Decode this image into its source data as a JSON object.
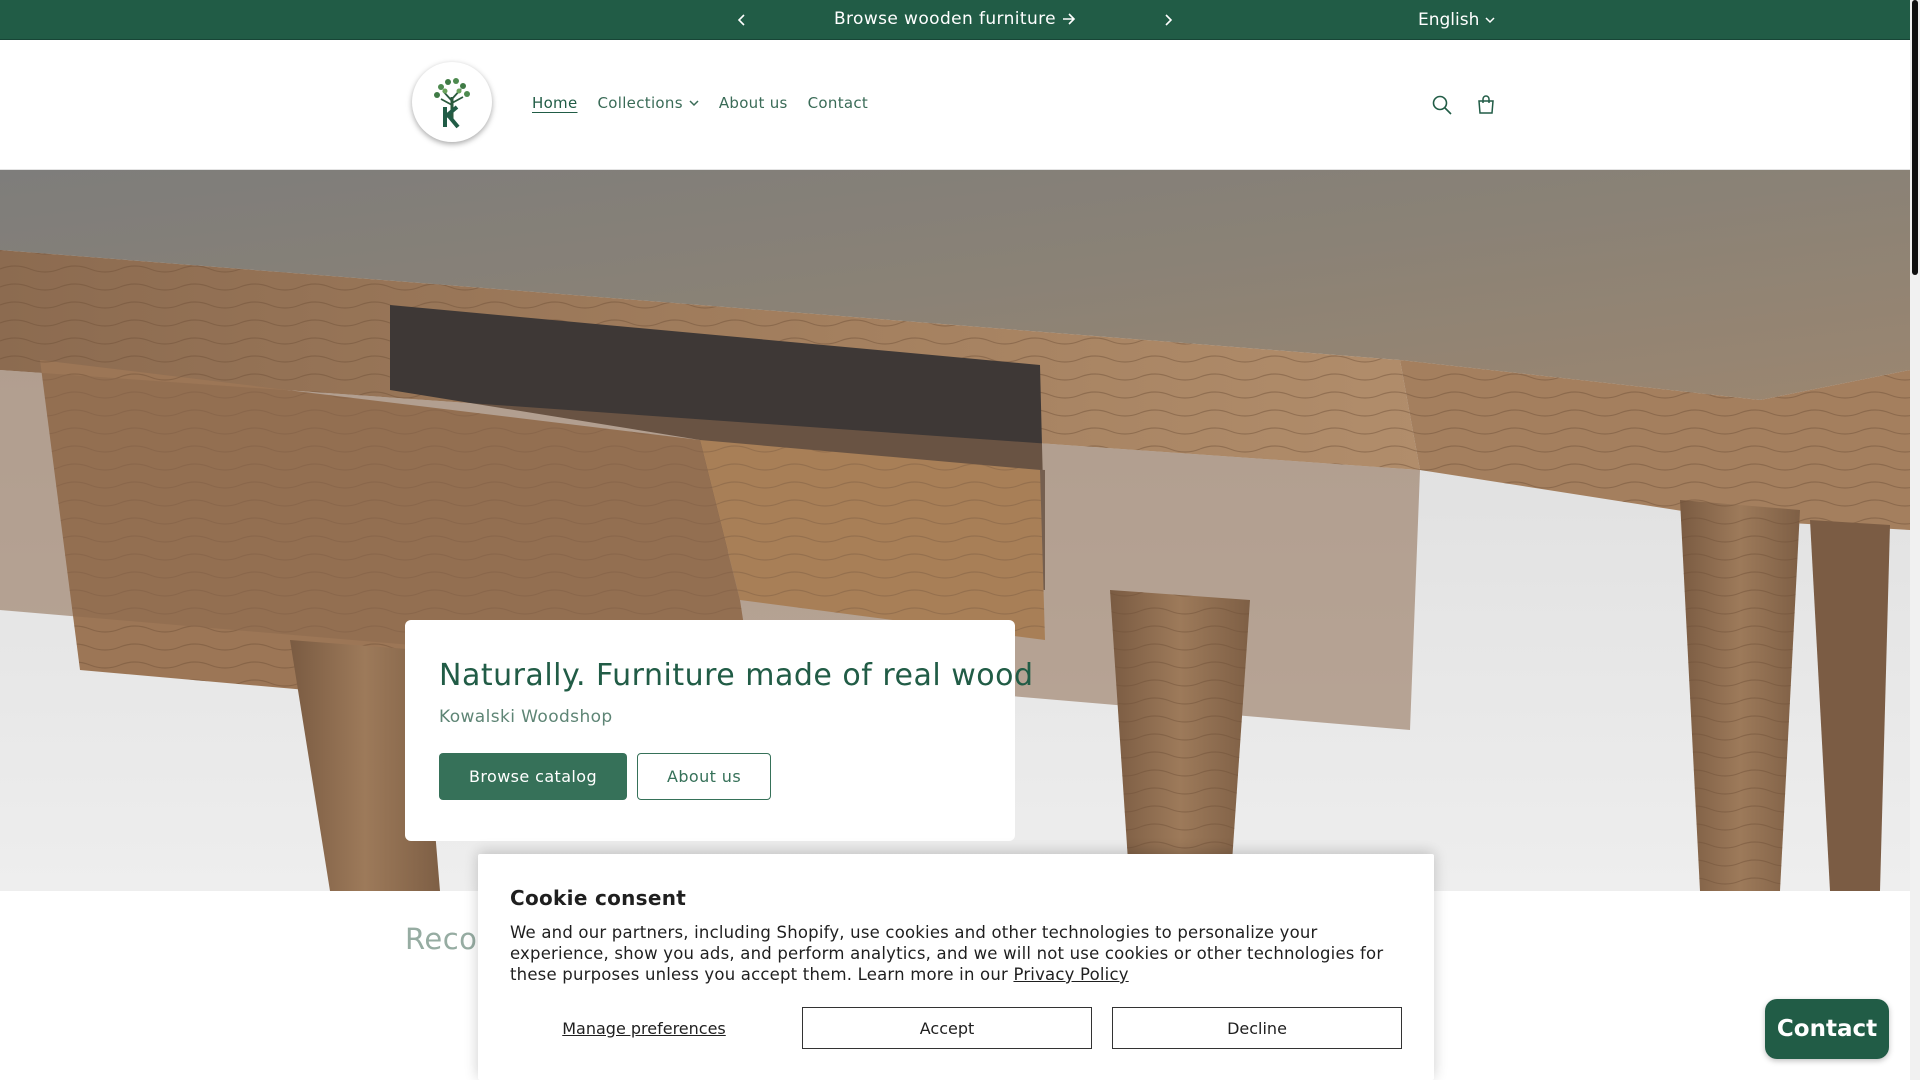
{
  "announcement": {
    "text": "Browse wooden furniture",
    "language": "English"
  },
  "header": {
    "nav": [
      {
        "label": "Home",
        "active": true
      },
      {
        "label": "Collections",
        "has_dropdown": true
      },
      {
        "label": "About us"
      },
      {
        "label": "Contact"
      }
    ],
    "icons": [
      "search-icon",
      "cart-icon"
    ]
  },
  "hero": {
    "title": "Naturally. Furniture made of real wood",
    "subtitle": "Kowalski Woodshop",
    "primary_button": "Browse catalog",
    "secondary_button": "About us"
  },
  "section": {
    "heading_visible": "Recor"
  },
  "cookie": {
    "title": "Cookie consent",
    "text": "We and our partners, including Shopify, use cookies and other technologies to personalize your experience, show you ads, and perform analytics, and we will not use cookies or other technologies for these purposes unless you accept them. Learn more in our ",
    "link": "Privacy Policy",
    "manage": "Manage preferences",
    "accept": "Accept",
    "decline": "Decline"
  },
  "chat": {
    "label": "Contact"
  },
  "colors": {
    "brand_green": "#215c46",
    "button_green": "#367159",
    "muted_green": "#5e8575"
  }
}
